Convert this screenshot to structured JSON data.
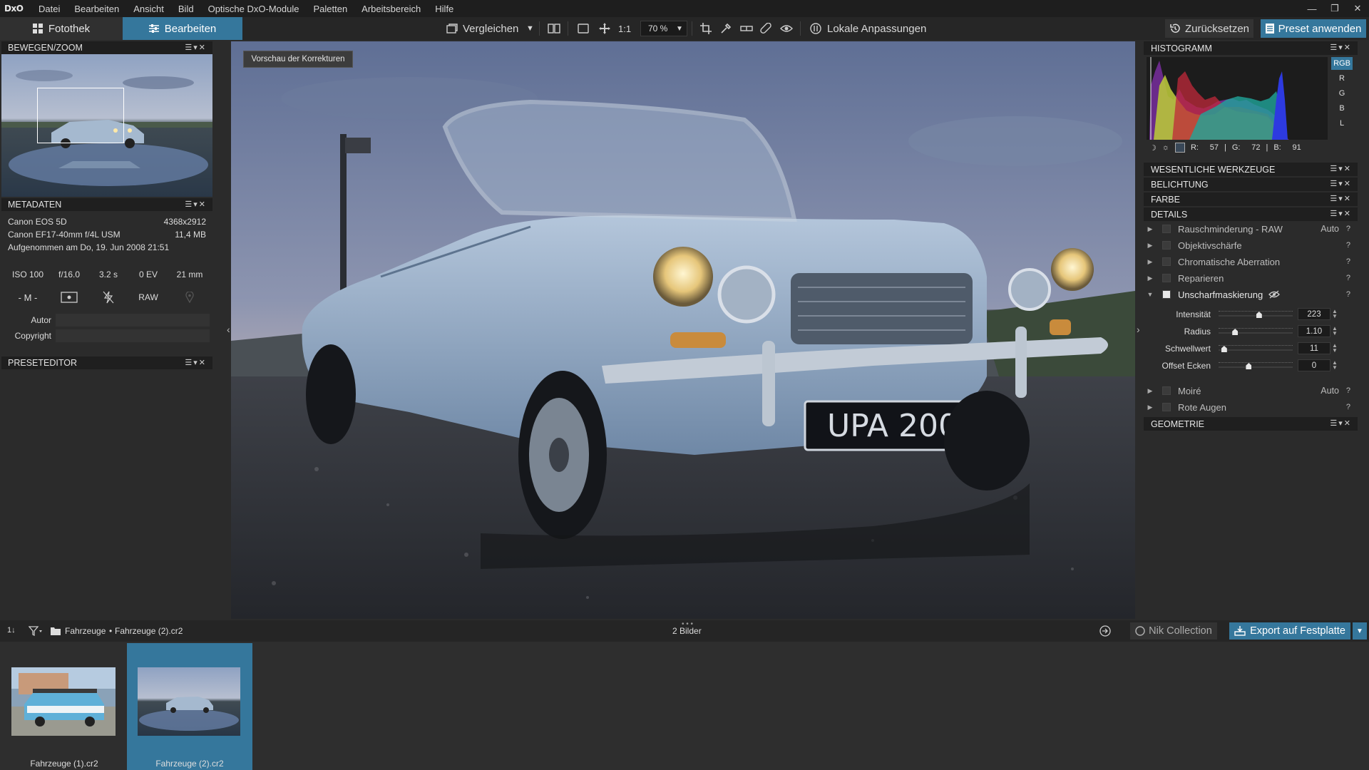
{
  "app": {
    "logo": "DxO"
  },
  "menu": [
    "Datei",
    "Bearbeiten",
    "Ansicht",
    "Bild",
    "Optische DxO-Module",
    "Paletten",
    "Arbeitsbereich",
    "Hilfe"
  ],
  "window_controls": {
    "minimize": "—",
    "restore": "❐",
    "close": "✕"
  },
  "toolbar": {
    "tab_library": "Fotothek",
    "tab_edit": "Bearbeiten",
    "compare": "Vergleichen",
    "one_to_one": "1:1",
    "zoom": "70 %",
    "local_adjustments": "Lokale Anpassungen",
    "reset": "Zurücksetzen",
    "apply_preset": "Preset anwenden",
    "active_tab_color": "#35779c"
  },
  "left_panel": {
    "navigator_title": "BEWEGEN/ZOOM",
    "metadata_title": "METADATEN",
    "camera": "Canon EOS 5D",
    "resolution": "4368x2912",
    "lens": "Canon EF17-40mm f/4L USM",
    "filesize": "11,4 MB",
    "taken": "Aufgenommen am Do, 19. Jun 2008 21:51",
    "exif": {
      "iso": "ISO 100",
      "aperture": "f/16.0",
      "shutter": "3.2 s",
      "ev": "0 EV",
      "focal": "21 mm"
    },
    "mode": "- M -",
    "format": "RAW",
    "author_label": "Autor",
    "author_value": "",
    "copyright_label": "Copyright",
    "copyright_value": "",
    "preset_editor_title": "PRESETEDITOR"
  },
  "viewer": {
    "preview_label": "Vorschau der Korrekturen"
  },
  "right_panel": {
    "histogram_title": "HISTOGRAMM",
    "channels": [
      "RGB",
      "R",
      "G",
      "B",
      "L"
    ],
    "active_channel": "RGB",
    "readout": {
      "r_label": "R:",
      "r": "57",
      "g_label": "G:",
      "g": "72",
      "b_label": "B:",
      "b": "91",
      "sep": "|"
    },
    "sections": {
      "essential": "WESENTLICHE WERKZEUGE",
      "exposure": "BELICHTUNG",
      "color": "FARBE",
      "details": "DETAILS",
      "geometry": "GEOMETRIE"
    },
    "tools": {
      "noise": "Rauschminderung - RAW",
      "noise_auto": "Auto",
      "lens_sharpness": "Objektivschärfe",
      "chromatic": "Chromatische Aberration",
      "repair": "Reparieren",
      "unsharp": "Unscharfmaskierung",
      "moire": "Moiré",
      "moire_auto": "Auto",
      "red_eye": "Rote Augen",
      "help": "?"
    },
    "unsharp_sliders": [
      {
        "label": "Intensität",
        "value": "223",
        "fraction": 0.55
      },
      {
        "label": "Radius",
        "value": "1.10",
        "fraction": 0.2
      },
      {
        "label": "Schwellwert",
        "value": "11",
        "fraction": 0.04
      },
      {
        "label": "Offset Ecken",
        "value": "0",
        "fraction": 0.4
      }
    ]
  },
  "bottom_bar": {
    "sort": "1↓",
    "folder": "Fahrzeuge",
    "sep": "•",
    "file": "Fahrzeuge (2).cr2",
    "count": "2 Bilder",
    "nik": "Nik Collection",
    "export": "Export auf Festplatte"
  },
  "filmstrip": [
    {
      "name": "Fahrzeuge (1).cr2",
      "selected": false
    },
    {
      "name": "Fahrzeuge (2).cr2",
      "selected": true
    }
  ]
}
